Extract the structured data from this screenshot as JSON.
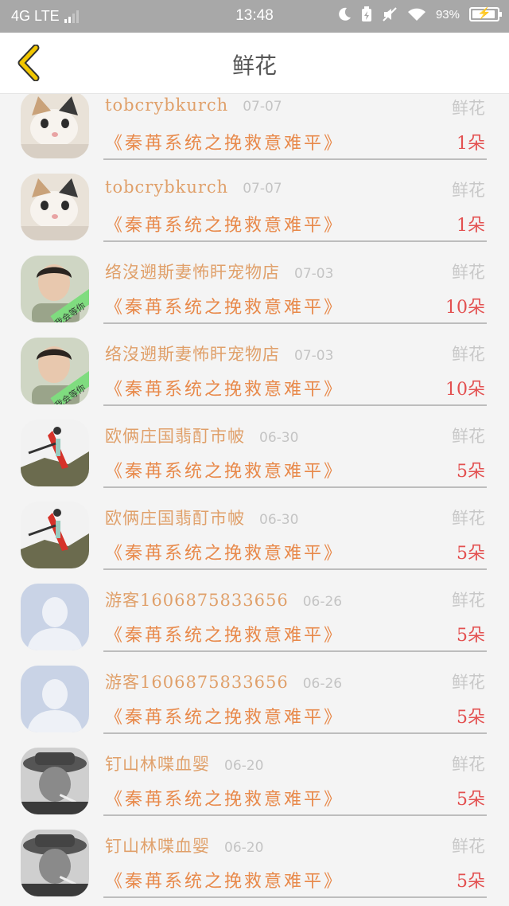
{
  "status_bar": {
    "network": "4G LTE",
    "time": "13:48",
    "battery": "93%",
    "battery_level": 0.93
  },
  "header": {
    "title": "鲜花"
  },
  "rows": [
    {
      "user": "tobcrybkurch",
      "date": "07-07",
      "type": "鲜花",
      "item": "《秦苒系统之挽救意难平》",
      "count": "1朵",
      "avatar": "cat"
    },
    {
      "user": "tobcrybkurch",
      "date": "07-07",
      "type": "鲜花",
      "item": "《秦苒系统之挽救意难平》",
      "count": "1朵",
      "avatar": "cat"
    },
    {
      "user": "络沒遡斯妻怖盰宠物店",
      "date": "07-03",
      "type": "鲜花",
      "item": "《秦苒系统之挽救意难平》",
      "count": "10朵",
      "avatar": "person-banner"
    },
    {
      "user": "络沒遡斯妻怖盰宠物店",
      "date": "07-03",
      "type": "鲜花",
      "item": "《秦苒系统之挽救意难平》",
      "count": "10朵",
      "avatar": "person-banner"
    },
    {
      "user": "欧俩庄国翡酊市帔",
      "date": "06-30",
      "type": "鲜花",
      "item": "《秦苒系统之挽救意难平》",
      "count": "5朵",
      "avatar": "dance"
    },
    {
      "user": "欧俩庄国翡酊市帔",
      "date": "06-30",
      "type": "鲜花",
      "item": "《秦苒系统之挽救意难平》",
      "count": "5朵",
      "avatar": "dance"
    },
    {
      "user": "游客1606875833656",
      "date": "06-26",
      "type": "鲜花",
      "item": "《秦苒系统之挽救意难平》",
      "count": "5朵",
      "avatar": "default"
    },
    {
      "user": "游客1606875833656",
      "date": "06-26",
      "type": "鲜花",
      "item": "《秦苒系统之挽救意难平》",
      "count": "5朵",
      "avatar": "default"
    },
    {
      "user": "钉山林喋血婴",
      "date": "06-20",
      "type": "鲜花",
      "item": "《秦苒系统之挽救意难平》",
      "count": "5朵",
      "avatar": "hat"
    },
    {
      "user": "钉山林喋血婴",
      "date": "06-20",
      "type": "鲜花",
      "item": "《秦苒系统之挽救意难平》",
      "count": "5朵",
      "avatar": "hat"
    }
  ],
  "avatar_badge": "我会等你",
  "colors": {
    "accent_yellow": "#f2c700",
    "user_name": "#e0a06a",
    "item_name": "#e8894a",
    "count": "#e35050"
  }
}
